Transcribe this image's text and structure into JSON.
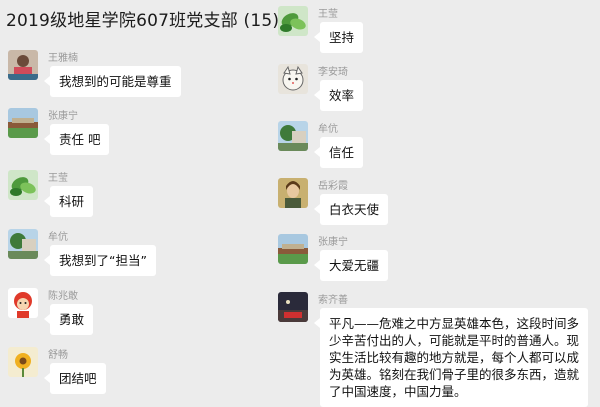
{
  "chat": {
    "title": "2019级地星学院607班党支部 (15)"
  },
  "left_messages": [
    {
      "name": "王雅楠",
      "text": "我想到的可能是尊重",
      "avatar_icon": "woman-photo-avatar"
    },
    {
      "name": "张康宁",
      "text": "责任 吧",
      "avatar_icon": "landscape-avatar"
    },
    {
      "name": "王莹",
      "text": "科研",
      "avatar_icon": "leaf-avatar"
    },
    {
      "name": "牟伉",
      "text": "我想到了“担当”",
      "avatar_icon": "tree-building-avatar"
    },
    {
      "name": "陈兆敢",
      "text": "勇敢",
      "avatar_icon": "cartoon-character-avatar"
    },
    {
      "name": "舒畅",
      "text": "团结吧",
      "avatar_icon": "sunflower-avatar"
    }
  ],
  "right_messages": [
    {
      "name": "王莹",
      "text": "坚持",
      "avatar_icon": "leaf-avatar"
    },
    {
      "name": "李安琦",
      "text": "效率",
      "avatar_icon": "cartoon-cat-avatar"
    },
    {
      "name": "牟伉",
      "text": "信任",
      "avatar_icon": "tree-building-avatar"
    },
    {
      "name": "岳彩霞",
      "text": "白衣天使",
      "avatar_icon": "painting-portrait-avatar"
    },
    {
      "name": "张康宁",
      "text": "大爱无疆",
      "avatar_icon": "landscape-avatar"
    },
    {
      "name": "索齐善",
      "text": "平凡——危难之中方显英雄本色，这段时间多少辛苦付出的人，可能就是平时的普通人。现实生活比较有趣的地方就是，每个人都可以成为英雄。铭刻在我们骨子里的很多东西，造就了中国速度，中国力量。",
      "avatar_icon": "dark-photo-avatar"
    }
  ]
}
